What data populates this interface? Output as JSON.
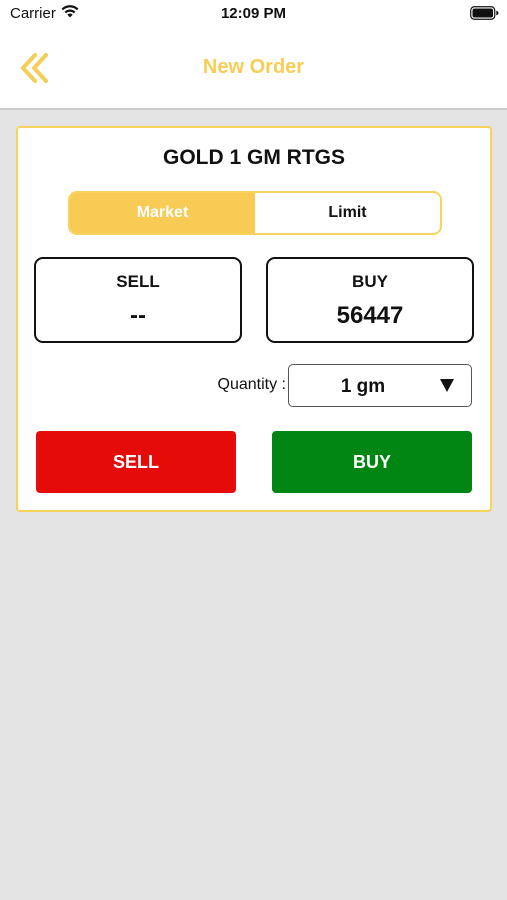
{
  "status_bar": {
    "carrier": "Carrier",
    "time": "12:09 PM",
    "icons": [
      "wifi-icon",
      "battery-icon"
    ]
  },
  "nav": {
    "title": "New Order",
    "back_icon": "double-chevron-left-icon",
    "accent_color": "#f7cd55"
  },
  "order": {
    "instrument": "GOLD 1 GM RTGS",
    "tabs": [
      {
        "label": "Market",
        "active": true
      },
      {
        "label": "Limit",
        "active": false
      }
    ],
    "sell_price": {
      "label": "SELL",
      "value": "--"
    },
    "buy_price": {
      "label": "BUY",
      "value": "56447"
    },
    "quantity": {
      "label": "Quantity :",
      "value": "1 gm",
      "icon": "caret-down-icon"
    },
    "actions": {
      "sell_label": "SELL",
      "buy_label": "BUY",
      "sell_color": "#e40b09",
      "buy_color": "#028613"
    }
  }
}
